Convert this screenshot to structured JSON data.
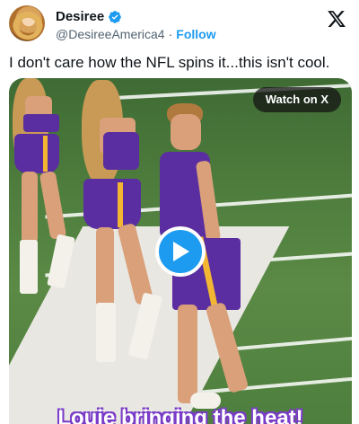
{
  "author": {
    "display_name": "Desiree",
    "handle": "@DesireeAmerica4",
    "separator": "·",
    "follow_label": "Follow"
  },
  "tweet": {
    "text": "I don't care how the NFL spins it...this isn't cool."
  },
  "media": {
    "watch_label": "Watch on X",
    "caption": "Louie bringing the heat!"
  },
  "icons": {
    "verified": "verified-badge-icon",
    "logo": "x-logo-icon",
    "play": "play-icon"
  },
  "colors": {
    "accent": "#1d9bf0",
    "text": "#0f1419",
    "muted": "#536471",
    "jersey_purple": "#5a2ea0",
    "jersey_gold": "#f2b632"
  }
}
